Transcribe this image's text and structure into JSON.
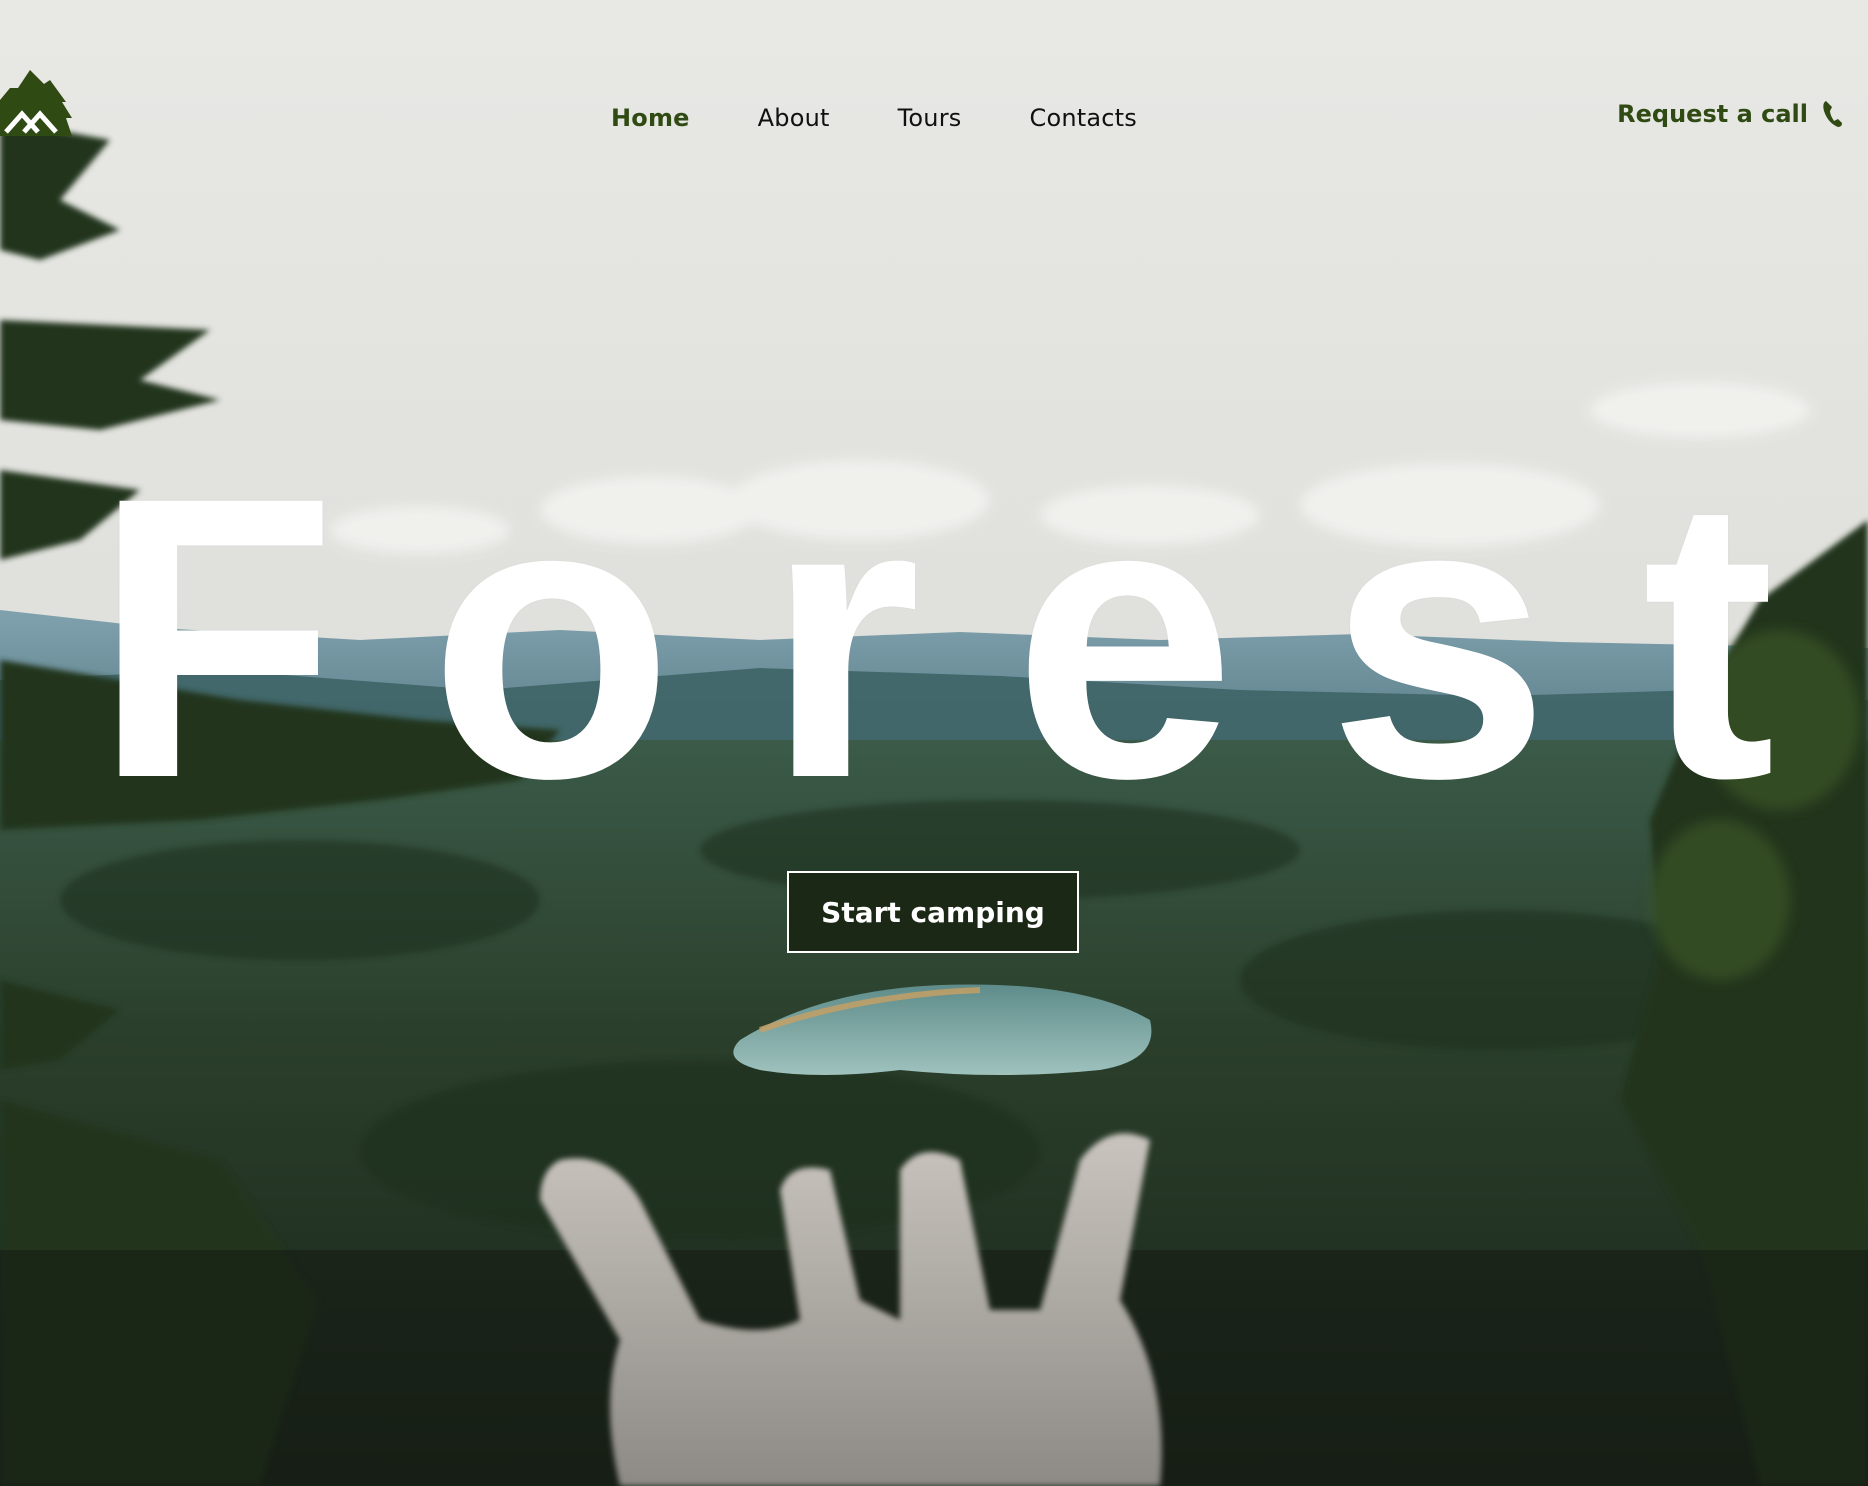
{
  "nav": {
    "items": [
      {
        "label": "Home",
        "active": true
      },
      {
        "label": "About",
        "active": false
      },
      {
        "label": "Tours",
        "active": false
      },
      {
        "label": "Contacts",
        "active": false
      }
    ],
    "request_call_label": "Request a call",
    "logo_icon": "mountain-tree-logo-icon",
    "phone_icon": "phone-icon"
  },
  "hero": {
    "title": "Forest",
    "cta_label": "Start camping"
  },
  "colors": {
    "accent": "#2f4a12",
    "cta_bg": "#1b2816",
    "title": "#ffffff"
  }
}
